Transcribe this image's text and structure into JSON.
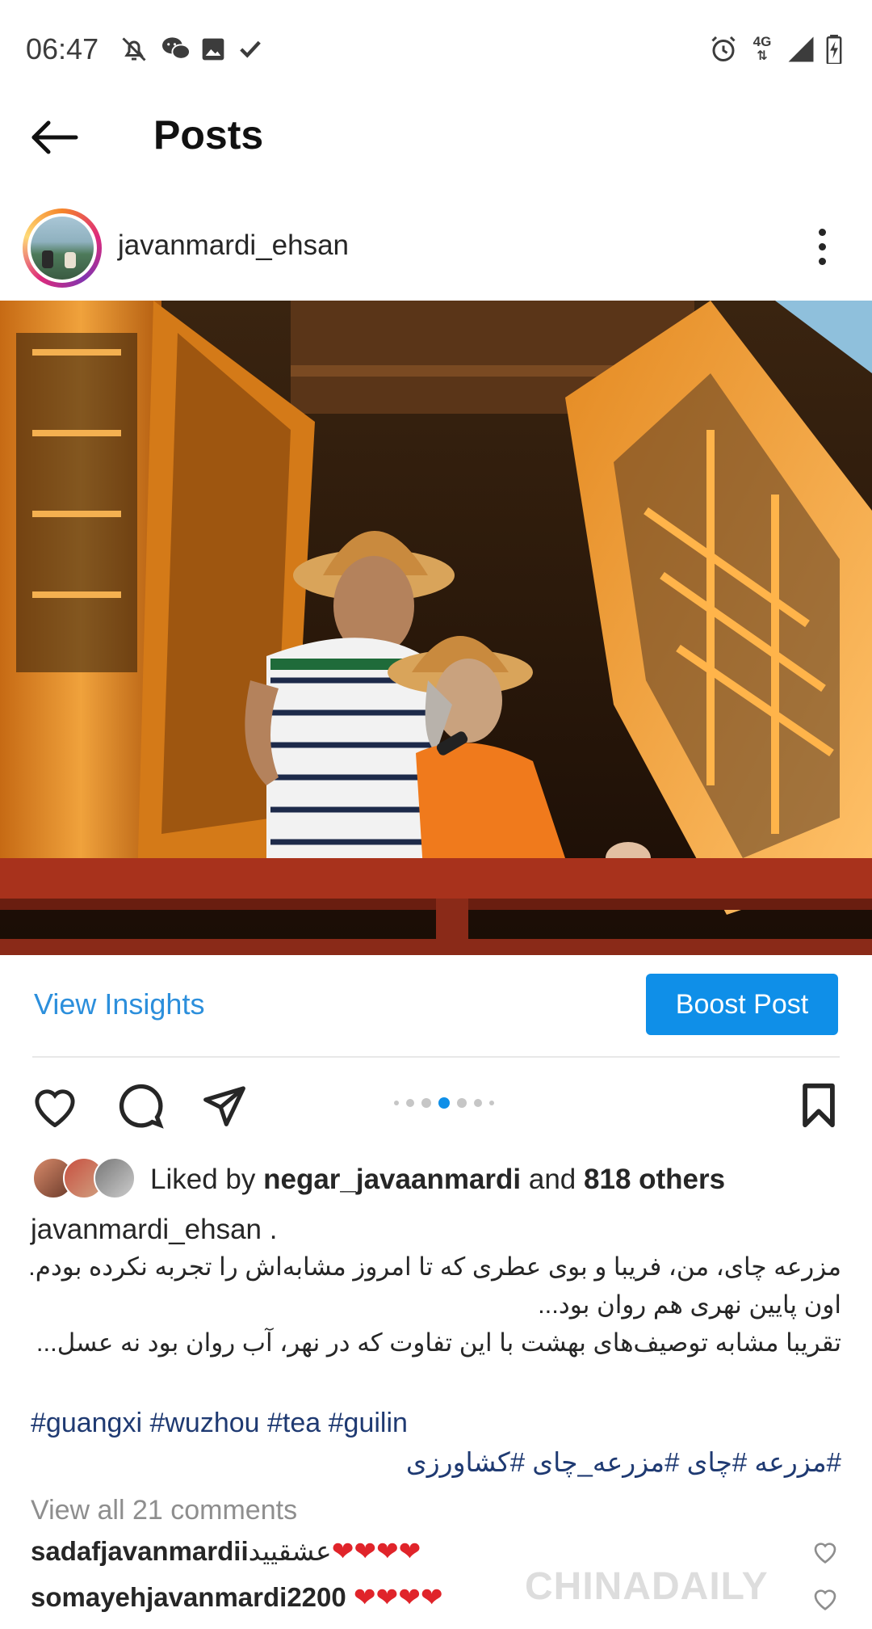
{
  "status_bar": {
    "time": "06:47",
    "network": "4G",
    "left_icons": [
      "notifications-off-icon",
      "wechat-icon",
      "gallery-icon",
      "check-icon"
    ],
    "right_icons": [
      "alarm-icon",
      "network-4g-icon",
      "signal-icon",
      "battery-charging-icon"
    ]
  },
  "header": {
    "title": "Posts",
    "back_icon": "arrow-left-icon"
  },
  "post": {
    "username": "javanmardi_ehsan",
    "more_icon": "more-vertical-icon",
    "view_insights_label": "View Insights",
    "boost_label": "Boost Post",
    "carousel": {
      "count": 7,
      "active_index": 3
    },
    "likes": {
      "prefix": "Liked by ",
      "user": "negar_javaanmardi",
      "middle": " and ",
      "others": "818 others"
    },
    "caption": {
      "username": "javanmardi_ehsan .",
      "lines": [
        "مزرعه چای، من، فریبا و بوی عطری که تا امروز مشابه‌اش را تجربه نکرده بودم.",
        "اون پایین نهری هم روان بود...",
        "تقریبا مشابه توصیف‌های بهشت با این تفاوت که در نهر، آب روان بود نه عسل..."
      ],
      "hashtags": "#guangxi #wuzhou #tea #guilin",
      "hashtags_fa": "#مزرعه #چای #مزرعه_چای #کشاورزی"
    },
    "view_comments": "View all 21 comments",
    "comments": [
      {
        "user": "sadafjavanmardii",
        "text": "عشقیید",
        "hearts": "❤❤❤❤"
      },
      {
        "user": "somayehjavanmardi2200",
        "text": "",
        "hearts": "❤❤❤❤"
      }
    ]
  },
  "watermark": "CHINADAILY",
  "colors": {
    "link": "#2c8fdc",
    "boost_button": "#0f8fe8",
    "hashtag": "#1f3a72",
    "heart": "#e0242a",
    "muted": "#8e8e8e"
  }
}
